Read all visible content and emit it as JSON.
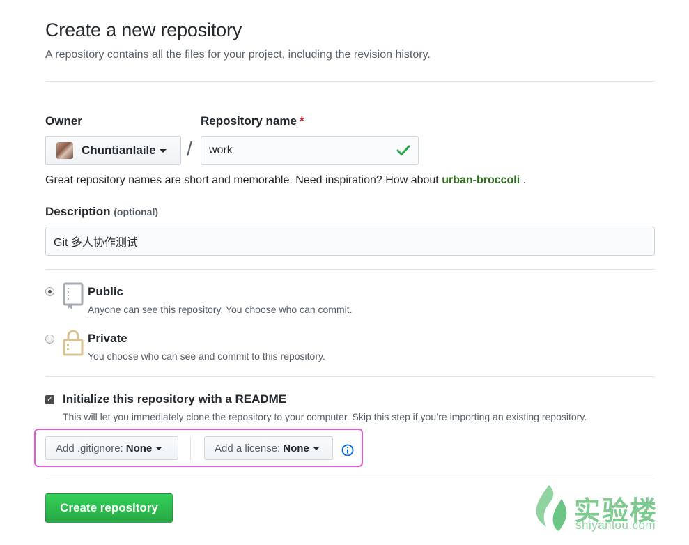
{
  "header": {
    "title": "Create a new repository",
    "subtitle": "A repository contains all the files for your project, including the revision history."
  },
  "owner": {
    "label": "Owner",
    "value": "Chuntianlaile"
  },
  "separator": "/",
  "repo_name": {
    "label": "Repository name",
    "required_mark": "*",
    "value": "work"
  },
  "hint": {
    "prefix": "Great repository names are short and memorable. Need inspiration? How about",
    "suggestion": "urban-broccoli",
    "suffix": "."
  },
  "description": {
    "label": "Description",
    "optional": "(optional)",
    "value": "Git 多人协作测试"
  },
  "visibility": {
    "selected": "Public",
    "options": [
      {
        "title": "Public",
        "desc": "Anyone can see this repository. You choose who can commit."
      },
      {
        "title": "Private",
        "desc": "You choose who can see and commit to this repository."
      }
    ]
  },
  "init": {
    "checked": true,
    "label": "Initialize this repository with a README",
    "desc": "This will let you immediately clone the repository to your computer. Skip this step if you’re importing an existing repository."
  },
  "gitignore": {
    "label": "Add .gitignore:",
    "value": "None"
  },
  "license": {
    "label": "Add a license:",
    "value": "None"
  },
  "submit": {
    "label": "Create repository"
  },
  "watermark": {
    "brand": "实验楼",
    "site": "shiyanlou.com"
  },
  "colors": {
    "primary_green": "#28a745",
    "suggestion_green": "#2c6e1b",
    "highlight_border": "#e25bd6",
    "info_blue": "#0366d6",
    "watermark_green": "#7ecb8f"
  }
}
